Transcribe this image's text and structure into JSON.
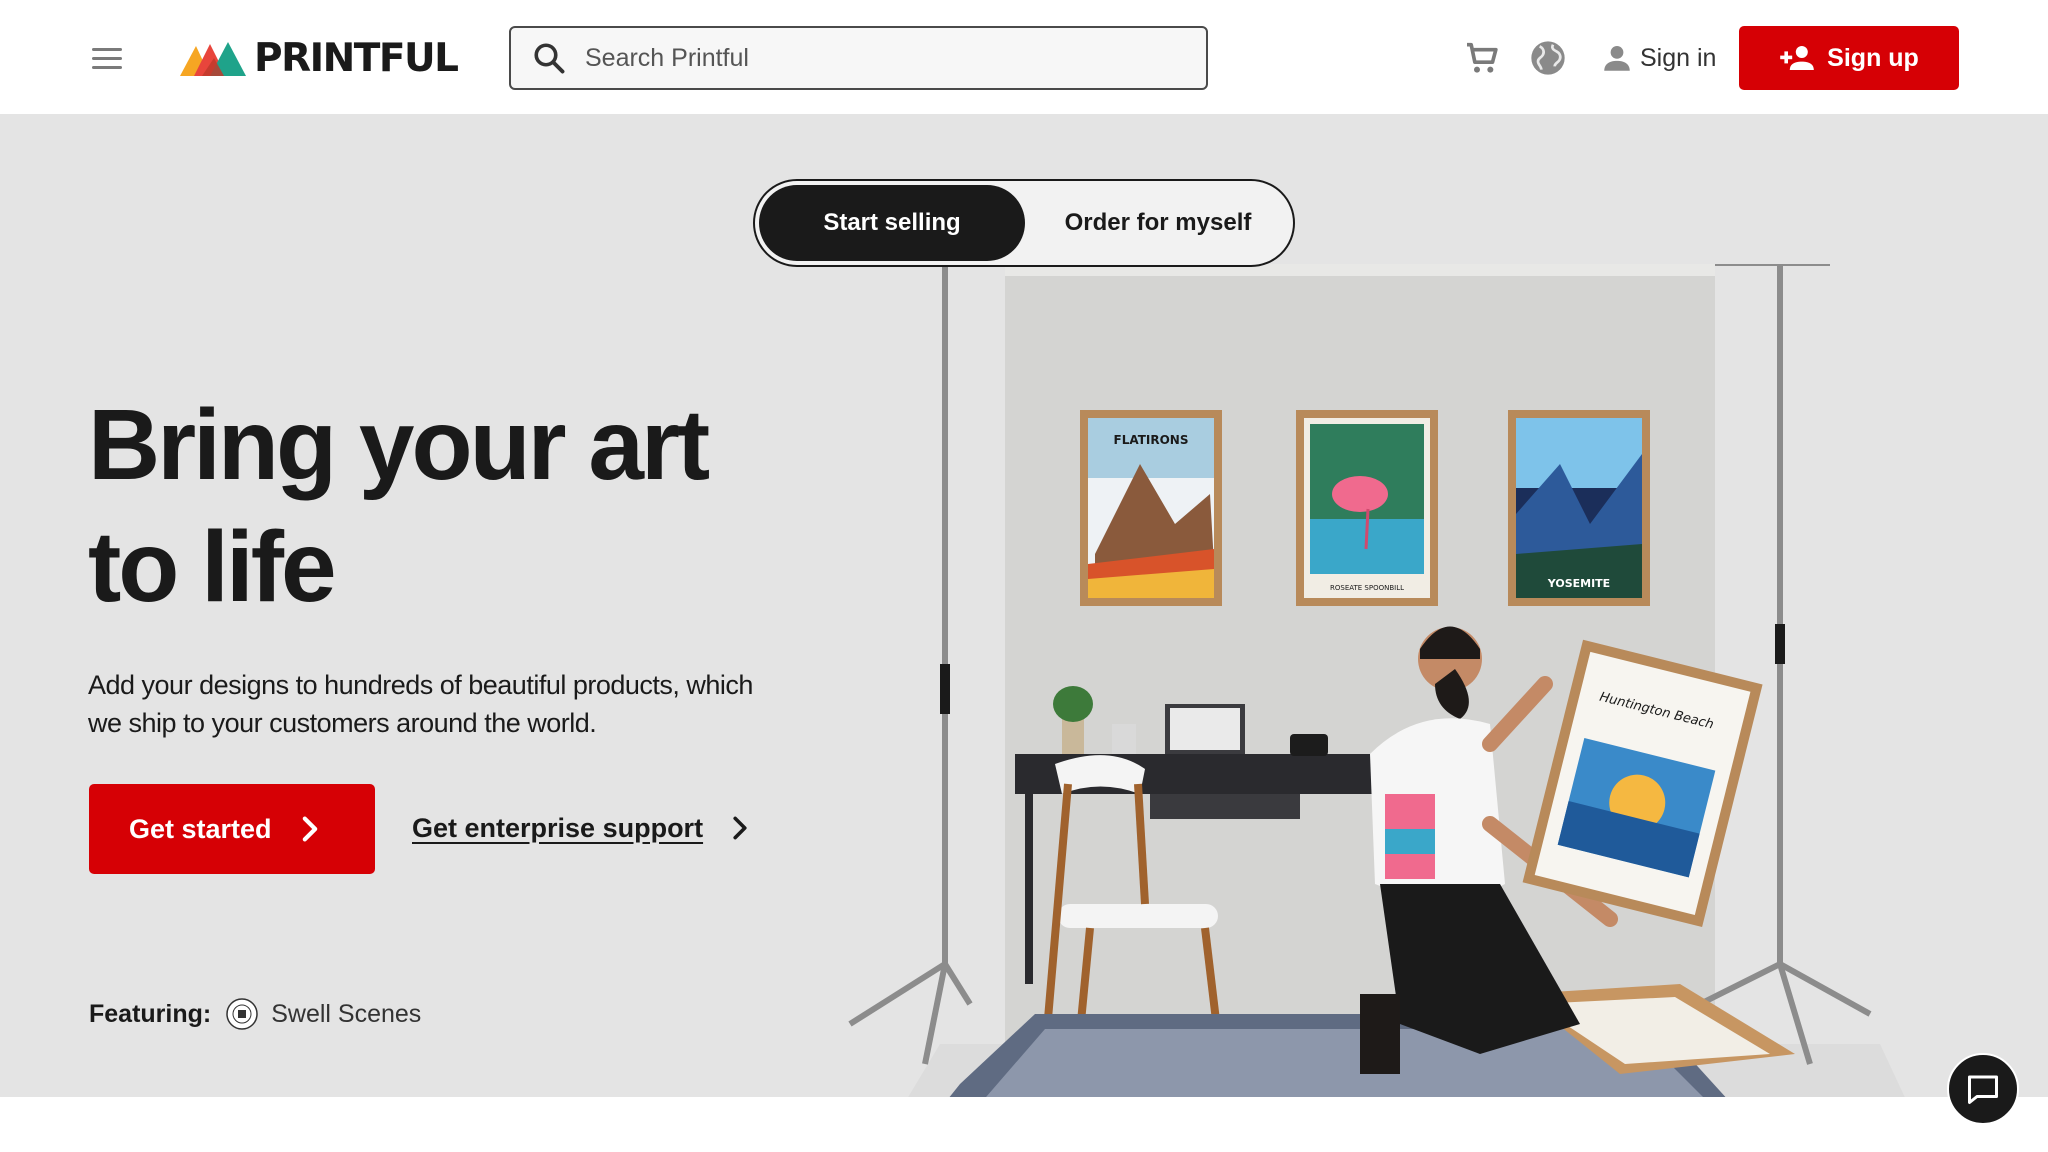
{
  "header": {
    "brand": "PRINTFUL",
    "search_placeholder": "Search Printful",
    "signin_label": "Sign in",
    "signup_label": "Sign up",
    "icons": [
      "menu-icon",
      "search-icon",
      "cart-icon",
      "globe-icon",
      "user-icon",
      "add-user-icon"
    ]
  },
  "hero": {
    "toggle": {
      "active": "Start selling",
      "inactive": "Order for myself"
    },
    "headline_line1": "Bring your art",
    "headline_line2": "to life",
    "subtext_line1": "Add your designs to hundreds of beautiful products, which",
    "subtext_line2": "we ship to your customers around the world.",
    "cta_label": "Get started",
    "enterprise_label": "Get enterprise support",
    "featuring_label": "Featuring:",
    "featuring_name": "Swell Scenes",
    "poster_titles": [
      "FLATIRONS",
      "ROSEATE SPOONBILL",
      "YOSEMITE",
      "Huntington Beach"
    ]
  },
  "colors": {
    "brand_red": "#d60005",
    "dark": "#1a1a1a",
    "hero_bg": "#e4e4e4"
  }
}
